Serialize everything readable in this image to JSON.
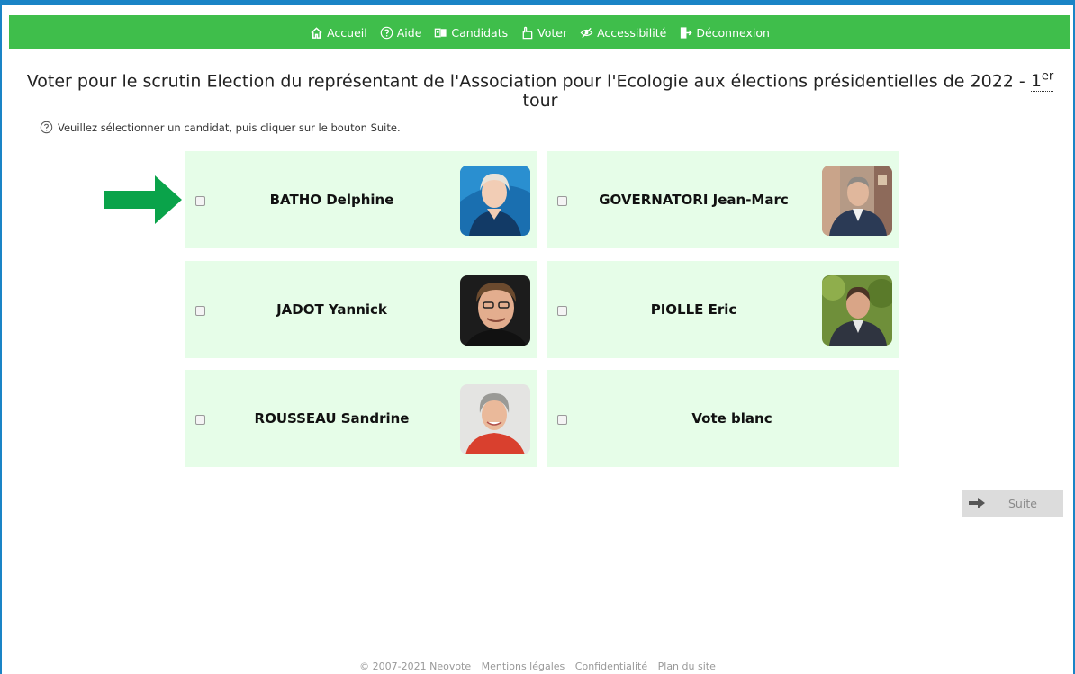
{
  "nav": {
    "items": [
      {
        "label": "Accueil",
        "icon": "home-icon"
      },
      {
        "label": "Aide",
        "icon": "help-icon"
      },
      {
        "label": "Candidats",
        "icon": "candidates-icon"
      },
      {
        "label": "Voter",
        "icon": "vote-icon"
      },
      {
        "label": "Accessibilité",
        "icon": "eye-slash-icon"
      },
      {
        "label": "Déconnexion",
        "icon": "logout-icon"
      }
    ]
  },
  "page": {
    "title_main": "Voter pour le scrutin Election du représentant de l'Association pour l'Ecologie aux élections présidentielles de 2022 - ",
    "title_num": "1",
    "title_sup": "er",
    "title_end": "tour",
    "help_text": "Veuillez sélectionner un candidat, puis cliquer sur le bouton Suite."
  },
  "candidates": [
    {
      "name": "BATHO Delphine",
      "has_photo": true
    },
    {
      "name": "GOVERNATORI Jean-Marc",
      "has_photo": true
    },
    {
      "name": "JADOT Yannick",
      "has_photo": true
    },
    {
      "name": "PIOLLE Eric",
      "has_photo": true
    },
    {
      "name": "ROUSSEAU Sandrine",
      "has_photo": true
    },
    {
      "name": "Vote blanc",
      "has_photo": false
    }
  ],
  "actions": {
    "next_label": "Suite"
  },
  "footer": {
    "copyright": "© 2007-2021 Neovote",
    "links": [
      "Mentions légales",
      "Confidentialité",
      "Plan du site"
    ]
  },
  "colors": {
    "navbar": "#3fbe4b",
    "card": "#e6fde8",
    "border": "#1a84c6",
    "arrow": "#0aa34a"
  }
}
